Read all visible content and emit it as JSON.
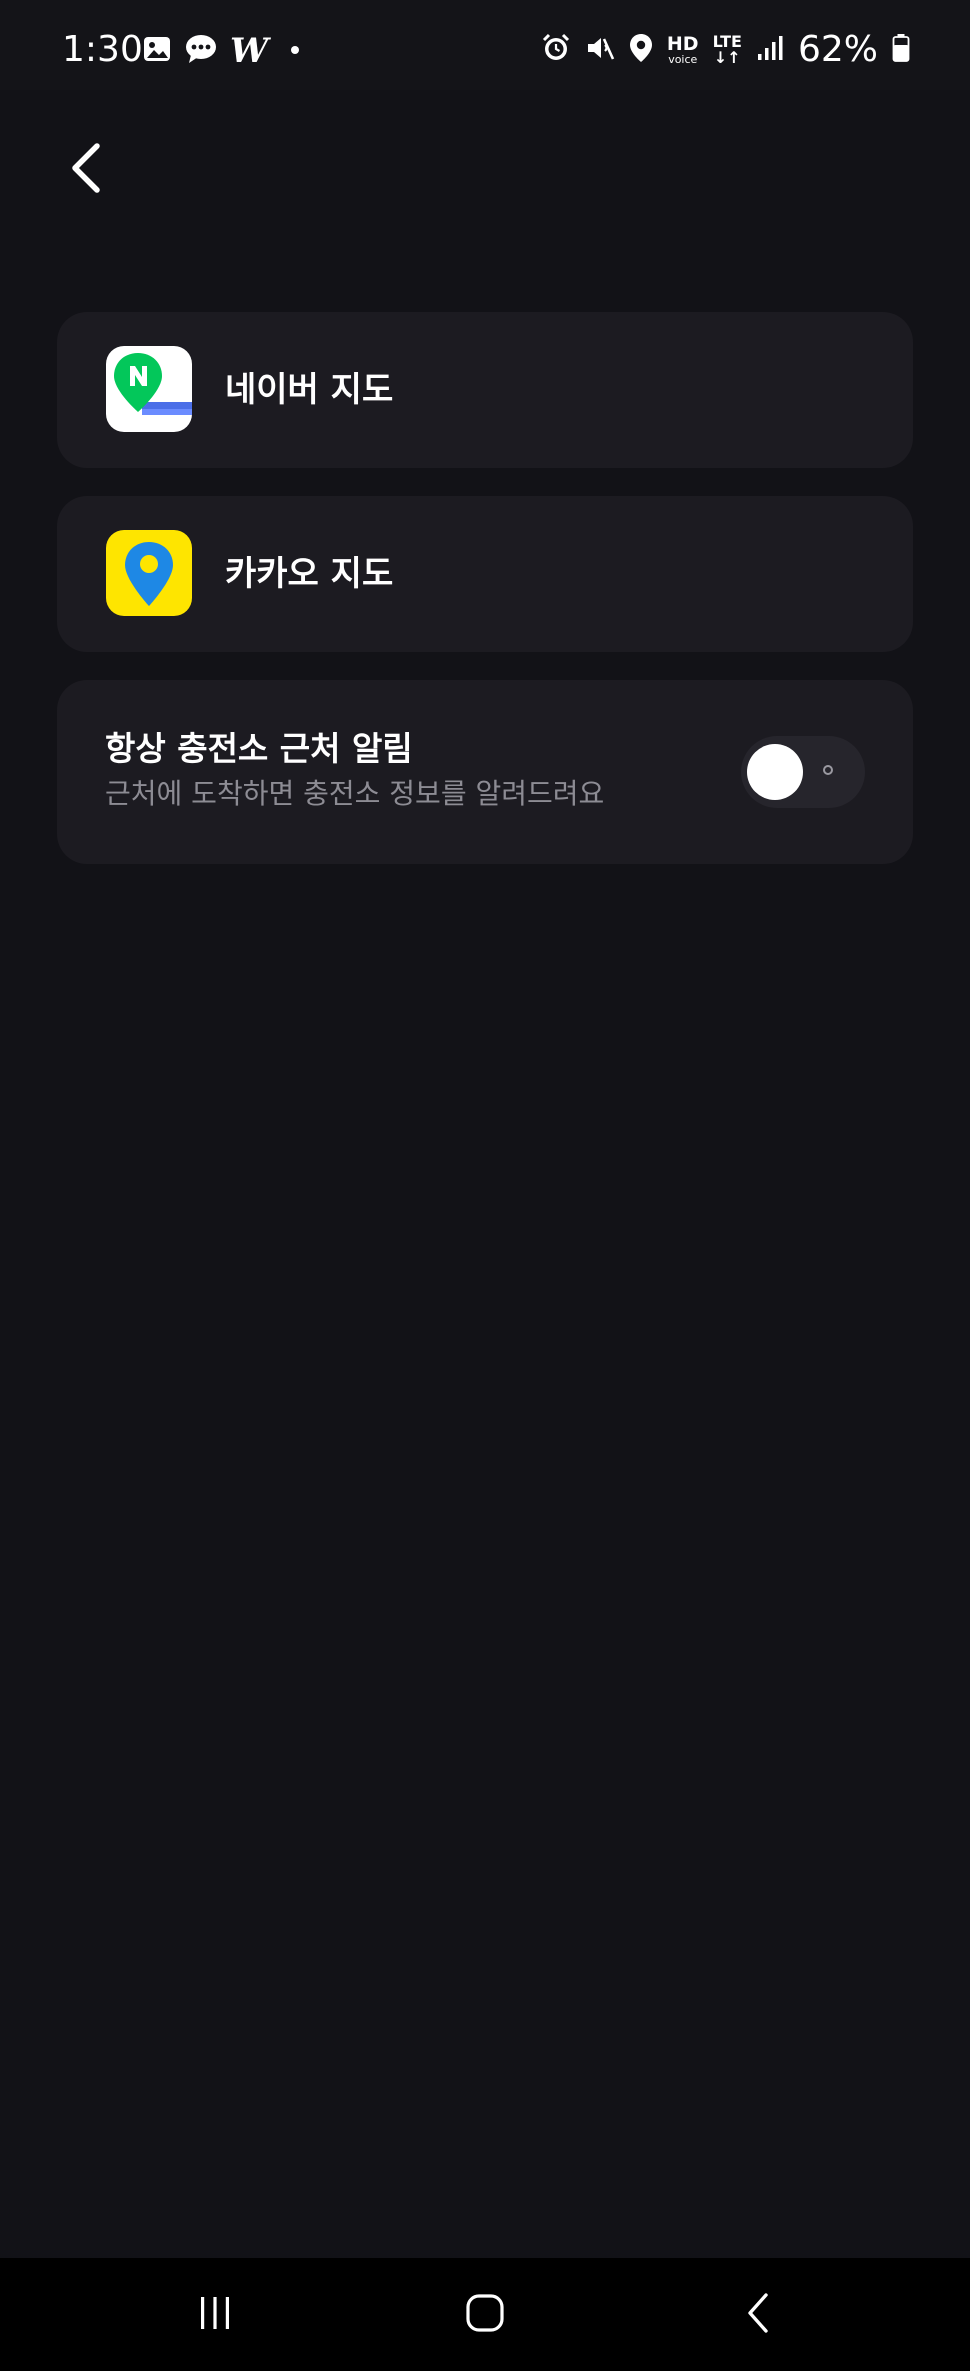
{
  "status_bar": {
    "time": "1:30",
    "notification_icons": [
      "gallery-icon",
      "message-icon",
      "w-app-icon",
      "dot-icon"
    ],
    "w_glyph": "W",
    "system_icons": [
      "alarm-icon",
      "mute-icon",
      "location-icon",
      "hd-voice-icon",
      "lte-icon",
      "signal-icon",
      "battery-icon"
    ],
    "hd_big": "HD",
    "hd_small": "voice",
    "lte_big": "LTE",
    "lte_small": "↓↑",
    "battery_percent": "62%"
  },
  "header": {
    "back_icon": "chevron-left-icon"
  },
  "map_apps": [
    {
      "label": "네이버 지도",
      "icon": "naver-map-icon"
    },
    {
      "label": "카카오 지도",
      "icon": "kakao-map-icon"
    }
  ],
  "nearby_alert": {
    "title": "항상 충전소 근처 알림",
    "description": "근처에 도착하면 충전소 정보를 알려드려요",
    "enabled": false
  },
  "nav_bar": {
    "buttons": [
      "recents-icon",
      "home-icon",
      "back-icon"
    ]
  },
  "colors": {
    "background": "#121217",
    "card": "#1c1b21",
    "secondary_text": "#8d8c94",
    "naver_green": "#03c75a",
    "naver_blue": "#4b6fe8",
    "kakao_yellow": "#fee500",
    "kakao_blue": "#1e88e5"
  }
}
